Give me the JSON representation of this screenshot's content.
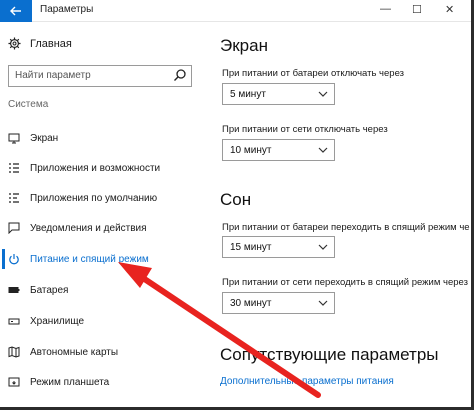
{
  "window": {
    "title": "Параметры",
    "back_icon": "arrow-left-icon",
    "minimize": "—",
    "maximize": "☐",
    "close": "✕"
  },
  "sidebar": {
    "home_label": "Главная",
    "search_placeholder": "Найти параметр",
    "section_label": "Система",
    "items": [
      {
        "label": "Экран",
        "icon": "monitor-icon"
      },
      {
        "label": "Приложения и возможности",
        "icon": "apps-list-icon"
      },
      {
        "label": "Приложения по умолчанию",
        "icon": "default-apps-icon"
      },
      {
        "label": "Уведомления и действия",
        "icon": "notification-icon"
      },
      {
        "label": "Питание и спящий режим",
        "icon": "power-icon"
      },
      {
        "label": "Батарея",
        "icon": "battery-icon"
      },
      {
        "label": "Хранилище",
        "icon": "storage-icon"
      },
      {
        "label": "Автономные карты",
        "icon": "map-icon"
      },
      {
        "label": "Режим планшета",
        "icon": "tablet-icon"
      }
    ]
  },
  "main": {
    "screen": {
      "heading": "Экран",
      "battery_label": "При питании от батареи отключать через",
      "battery_value": "5 минут",
      "ac_label": "При питании от сети отключать через",
      "ac_value": "10 минут"
    },
    "sleep": {
      "heading": "Сон",
      "battery_label": "При питании от батареи переходить в спящий режим че",
      "battery_value": "15 минут",
      "ac_label": "При питании от сети переходить в спящий режим через",
      "ac_value": "30 минут"
    },
    "related": {
      "heading": "Сопутствующие параметры",
      "link": "Дополнительные параметры питания"
    }
  },
  "colors": {
    "accent": "#0a6fcf",
    "annotation_arrow": "#e8231f"
  }
}
